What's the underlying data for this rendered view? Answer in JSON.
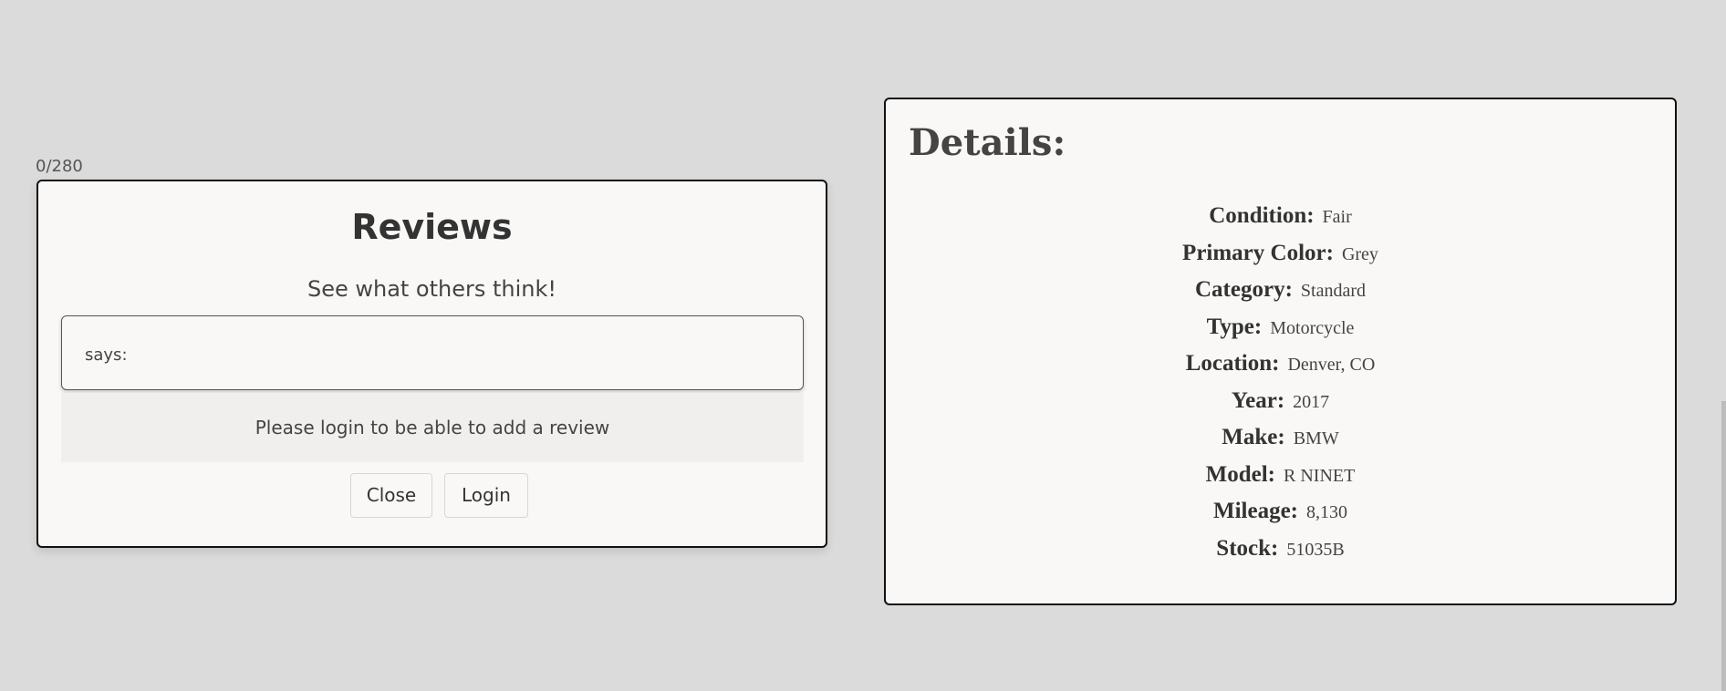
{
  "reviews": {
    "char_counter": "0/280",
    "title": "Reviews",
    "subtitle": "See what others think!",
    "review_items": [
      {
        "says": "says:"
      }
    ],
    "login_notice": "Please login to be able to add a review",
    "close_label": "Close",
    "login_label": "Login"
  },
  "details": {
    "title": "Details:",
    "items": [
      {
        "label": "Condition:",
        "value": "Fair"
      },
      {
        "label": "Primary Color:",
        "value": "Grey"
      },
      {
        "label": "Category:",
        "value": "Standard"
      },
      {
        "label": "Type:",
        "value": "Motorcycle"
      },
      {
        "label": "Location:",
        "value": "Denver, CO"
      },
      {
        "label": "Year:",
        "value": "2017"
      },
      {
        "label": "Make:",
        "value": "BMW"
      },
      {
        "label": "Model:",
        "value": "R NINET"
      },
      {
        "label": "Mileage:",
        "value": "8,130"
      },
      {
        "label": "Stock:",
        "value": "51035B"
      }
    ]
  }
}
